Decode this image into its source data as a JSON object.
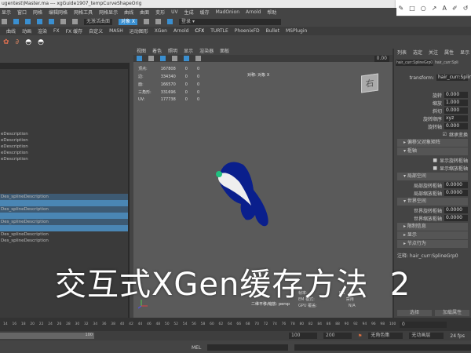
{
  "titlebar": {
    "title": "ugentest\\Master.ma  ---  xgGuide1907_tempCurveShapeOrig"
  },
  "annotation_tools": [
    "pen-icon",
    "rectangle-icon",
    "circle-icon",
    "arrow-icon",
    "A",
    "highlighter-icon",
    "undo-icon"
  ],
  "menubar": {
    "items": [
      "显示",
      "窗口",
      "网格",
      "编辑网格",
      "网格工具",
      "网格显示",
      "曲线",
      "曲面",
      "变形",
      "UV",
      "生成",
      "缓存",
      "MadOnion",
      "Arnold",
      "帮助"
    ]
  },
  "toolbar": {
    "live_surface": "无激活曲面",
    "symmetry": "对象 X",
    "login": "登录"
  },
  "shelf_tabs": [
    "曲线",
    "动画",
    "渲染",
    "FX",
    "FX 缓存",
    "自定义",
    "MASH",
    "运动图形",
    "XGen",
    "Arnold",
    "CFX",
    "TURTLE",
    "PhoenixFD",
    "Bullet",
    "MSPlugin"
  ],
  "outliner": {
    "items": [
      "eDescription",
      "eDescription",
      "eDescription",
      "eDescription",
      "eDescription",
      "",
      "",
      "",
      "",
      "",
      "Des_splineDescription",
      "",
      "Des_splineDescription",
      "",
      "Des_splineDescription",
      "",
      "Des_splineDescription",
      "Des_splineDescription"
    ]
  },
  "viewport": {
    "menu": [
      "视图",
      "着色",
      "照明",
      "显示",
      "渲染器",
      "面板"
    ],
    "stats": [
      [
        "顶点:",
        "167808",
        "0",
        "0"
      ],
      [
        "边:",
        "334340",
        "0",
        "0"
      ],
      [
        "面:",
        "166570",
        "0",
        "0"
      ],
      [
        "三角形:",
        "331696",
        "0",
        "0"
      ],
      [
        "UV:",
        "177738",
        "0",
        "0"
      ]
    ],
    "symmetry_label": "对称: 对象 X",
    "viewcube": "右",
    "camera_label": "二维平移/缩放: persp",
    "hud": [
      [
        "帧率:",
        "DG"
      ],
      [
        "EM 模式:",
        "禁用"
      ],
      [
        "GPU 覆盖:",
        "N/A"
      ]
    ],
    "toolbar_value": "0.00",
    "character_color": "#0a1f8c"
  },
  "attr_editor": {
    "tabs": [
      "列表",
      "选定",
      "关注",
      "属性",
      "显示",
      "显示"
    ],
    "node_tabs": [
      "hair_curr:SplineGrp0",
      "hair_curr:Spli"
    ],
    "transform_label": "transform:",
    "transform_value": "hair_curr:Splin",
    "fields": [
      [
        "旋转",
        "0.000"
      ],
      [
        "缩放",
        "1.000"
      ],
      [
        "斜切",
        "0.000"
      ],
      [
        "旋转顺序",
        "xyz"
      ],
      [
        "旋转轴",
        "0.000"
      ]
    ],
    "inherit": "继承变换",
    "sections": [
      "偏移父对象矩阵",
      "枢轴",
      "局部空间",
      "世界空间",
      "限制信息",
      "显示",
      "节点行为"
    ],
    "pivot_checks": [
      "显示旋转枢轴",
      "显示缩放枢轴"
    ],
    "local": [
      [
        "局部旋转枢轴",
        "0.0000"
      ],
      [
        "局部缩放枢轴",
        "0.0000"
      ]
    ],
    "world": [
      [
        "世界旋转枢轴",
        "0.0000"
      ],
      [
        "世界缩放枢轴",
        "0.0000"
      ]
    ],
    "notes": "注释: hair_curr:SplineGrp0",
    "buttons": [
      "选择",
      "加载属性"
    ]
  },
  "overlay_title": "交互式XGen缓存方法  2",
  "timeline": {
    "ticks": [
      "14",
      "16",
      "18",
      "20",
      "22",
      "24",
      "26",
      "28",
      "30",
      "32",
      "34",
      "36",
      "38",
      "40",
      "42",
      "44",
      "46",
      "48",
      "50",
      "52",
      "54",
      "56",
      "58",
      "60",
      "62",
      "64",
      "66",
      "68",
      "70",
      "72",
      "74",
      "76",
      "78",
      "80",
      "82",
      "84",
      "86",
      "88",
      "90",
      "92",
      "94",
      "96",
      "98",
      "100"
    ],
    "current": "0"
  },
  "range": {
    "end_inner": "100",
    "end": "100",
    "end_outer": "200",
    "character_set": "无角色集",
    "anim_layer": "无动画层",
    "fps": "24 fps"
  },
  "mel": {
    "label": "MEL"
  }
}
